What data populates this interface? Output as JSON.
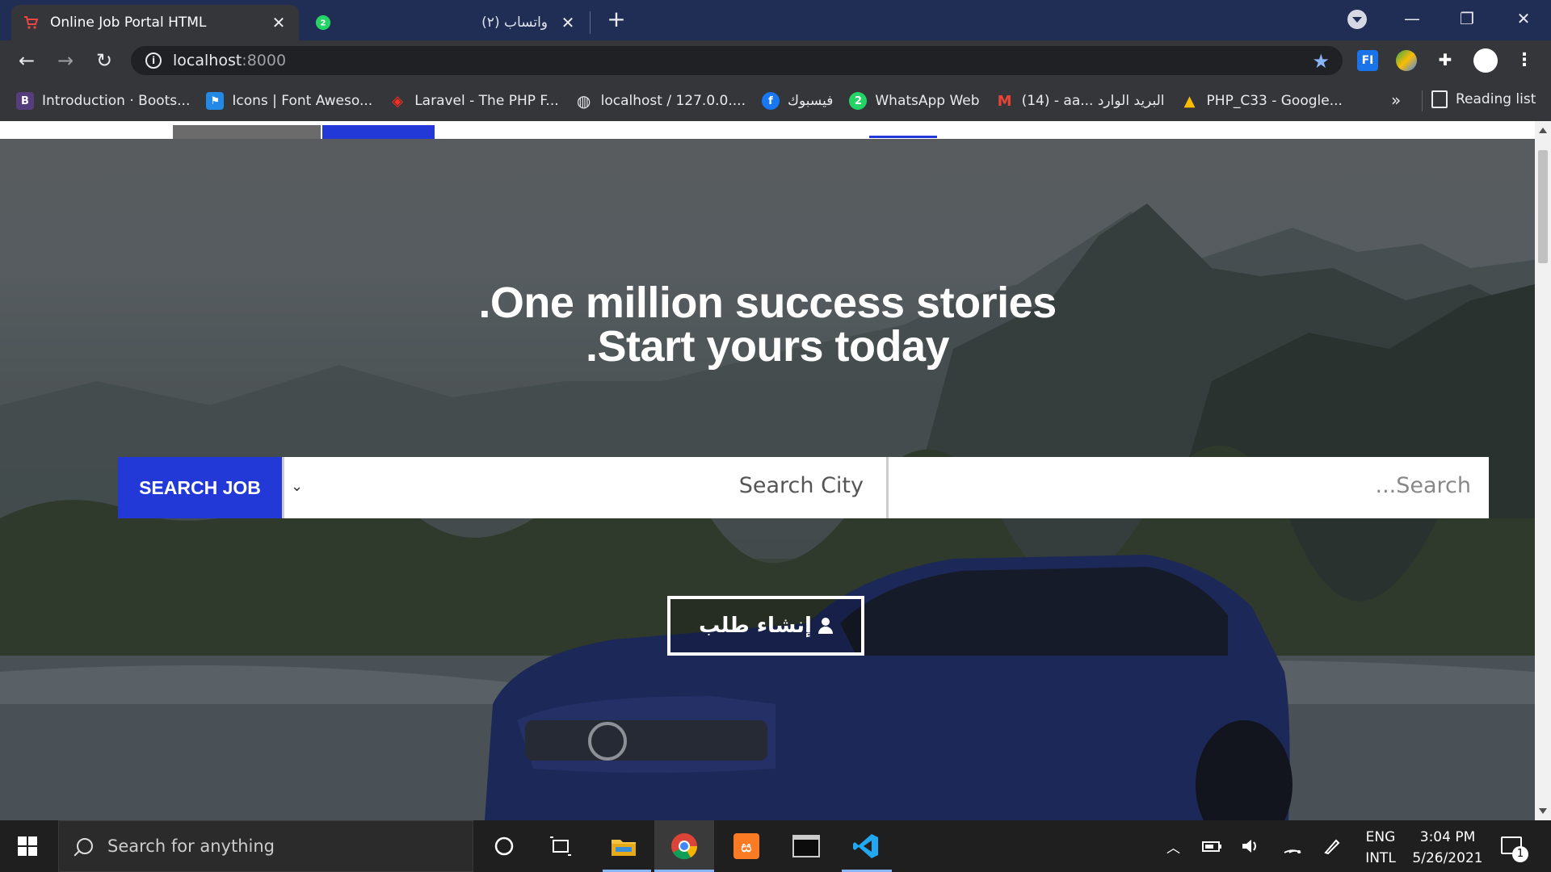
{
  "browser": {
    "tabs": [
      {
        "title": "Online Job Portal HTML",
        "active": true
      },
      {
        "title": "(٢) واتساب",
        "badge": "2",
        "active": false
      }
    ],
    "address": {
      "host": "localhost",
      "port": ":8000"
    },
    "bookmarks": [
      {
        "label": "Introduction · Boots...",
        "icon": "B",
        "color": "#563d7c"
      },
      {
        "label": "Icons | Font Aweso...",
        "icon": "⚑",
        "color": "#228ae6"
      },
      {
        "label": "Laravel - The PHP F...",
        "icon": "L",
        "color": "#ff2d20"
      },
      {
        "label": "localhost / 127.0.0....",
        "icon": "◍",
        "color": "#5f6368"
      },
      {
        "label": "فيسبوك",
        "icon": "f",
        "color": "#1877f2"
      },
      {
        "label": "WhatsApp Web",
        "icon": "2",
        "color": "#25d366"
      },
      {
        "label": "(14) - aa... البريد الوارد",
        "icon": "M",
        "color": "#ea4335"
      },
      {
        "label": "PHP_C33 - Google...",
        "icon": "▲",
        "color": "#fbbc04"
      }
    ],
    "bookmarks_more": "»",
    "reading_list": "Reading list"
  },
  "hero": {
    "headline_line1": ".One million success stories",
    "headline_line2": ".Start yours today",
    "search_button": "SEARCH JOB",
    "city_select_value": "Search City",
    "search_placeholder": "...Search",
    "create_button": "إنشاء طلب"
  },
  "taskbar": {
    "search_text": "Search for anything",
    "lang_line1": "ENG",
    "lang_line2": "INTL",
    "time": "3:04 PM",
    "date": "5/26/2021",
    "notification_count": "1"
  },
  "colors": {
    "accent_blue": "#2239d8",
    "tab_bar": "#202d55",
    "toolbar": "#35363a"
  }
}
